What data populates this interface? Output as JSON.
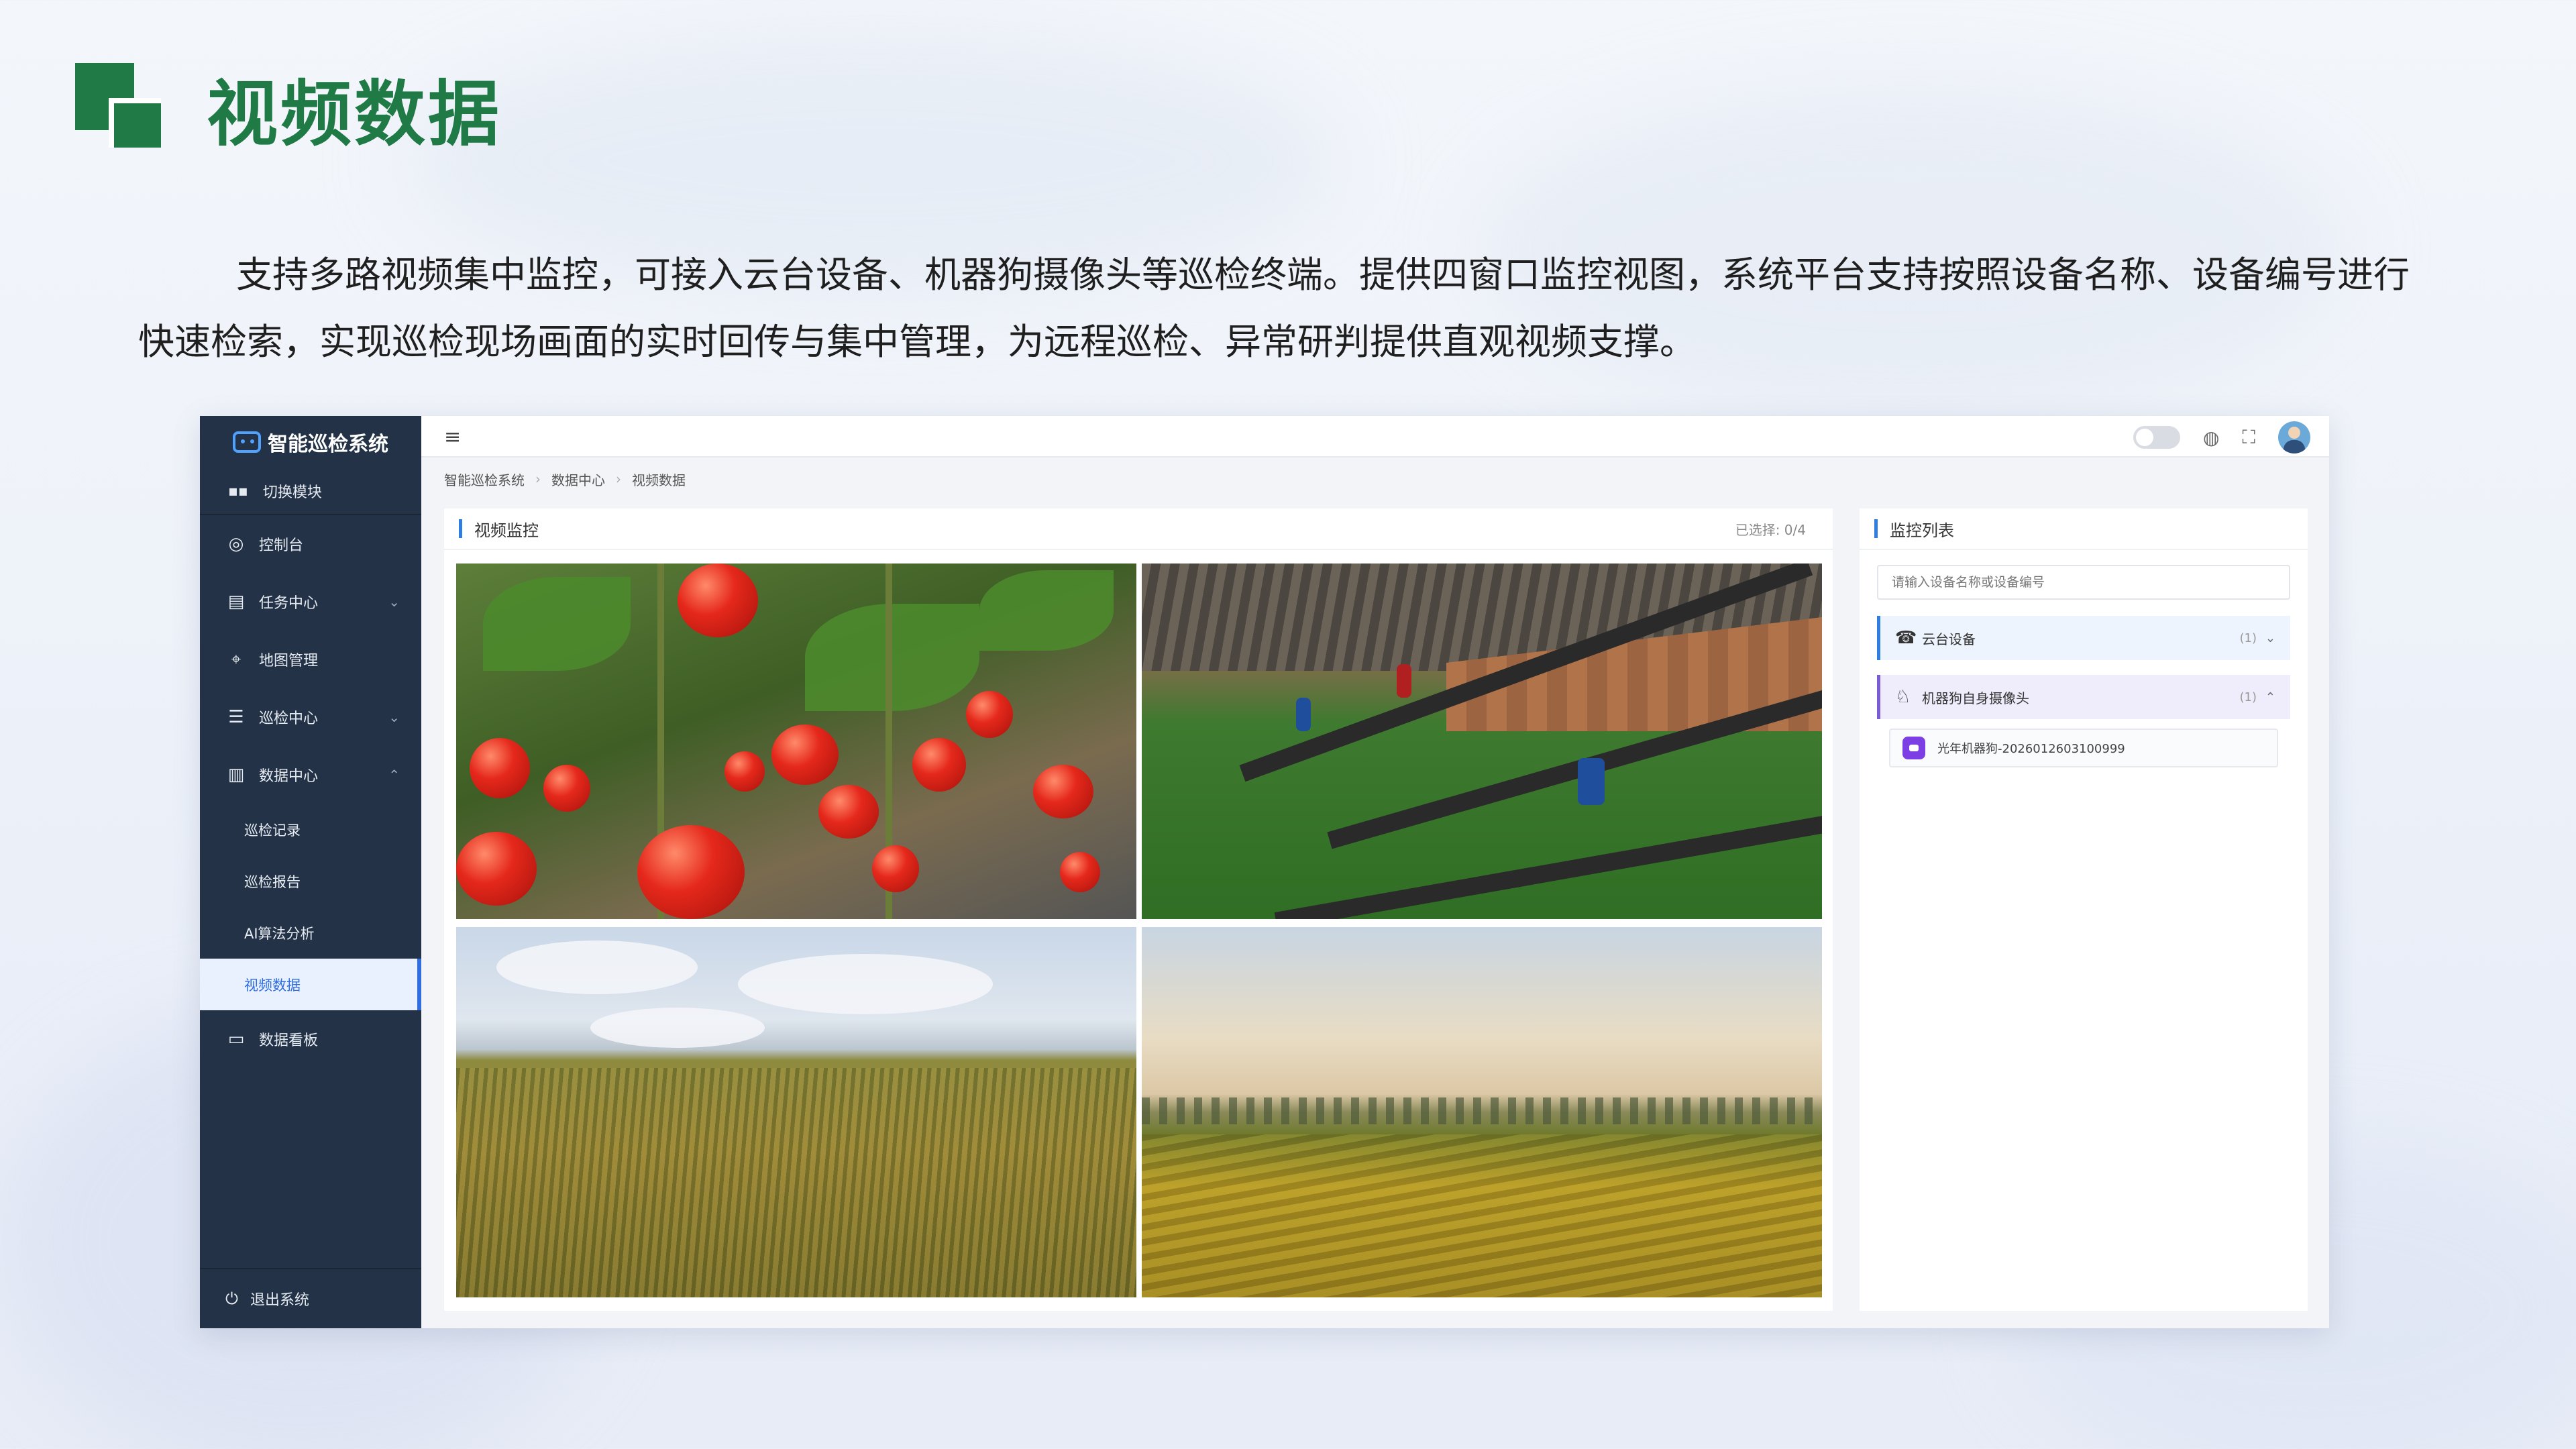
{
  "slide": {
    "title": "视频数据",
    "description": "支持多路视频集中监控，可接入云台设备、机器狗摄像头等巡检终端。提供四窗口监控视图，系统平台支持按照设备名称、设备编号进行快速检索，实现巡检现场画面的实时回传与集中管理，为远程巡检、异常研判提供直观视频支撑。"
  },
  "app": {
    "brand": "智能巡检系统",
    "switch_module": "切换模块",
    "menu": [
      {
        "label": "控制台",
        "icon": "dashboard-icon"
      },
      {
        "label": "任务中心",
        "icon": "task-icon",
        "chevron": "⌄"
      },
      {
        "label": "地图管理",
        "icon": "map-pin-icon"
      },
      {
        "label": "巡检中心",
        "icon": "inspection-icon",
        "chevron": "⌄"
      },
      {
        "label": "数据中心",
        "icon": "data-center-icon",
        "chevron": "⌃"
      }
    ],
    "submenu": [
      "巡检记录",
      "巡检报告",
      "AI算法分析",
      "视频数据"
    ],
    "dashboard_menu": "数据看板",
    "logout": "退出系统",
    "breadcrumb": [
      "智能巡检系统",
      "数据中心",
      "视频数据"
    ],
    "video_panel": {
      "title": "视频监控",
      "selected_text": "已选择: 0/4"
    },
    "list_panel": {
      "title": "监控列表",
      "search_placeholder": "请输入设备名称或设备编号",
      "groups": [
        {
          "label": "云台设备",
          "count": "(1)",
          "arrow": "⌄",
          "icon": "ptz-camera-icon"
        },
        {
          "label": "机器狗自身摄像头",
          "count": "(1)",
          "arrow": "⌃",
          "icon": "robot-dog-icon"
        }
      ],
      "device": "光年机器狗-2026012603100999"
    },
    "colors": {
      "sidebar": "#233246",
      "accent": "#2f7de1",
      "title_green": "#1f7a45"
    }
  }
}
